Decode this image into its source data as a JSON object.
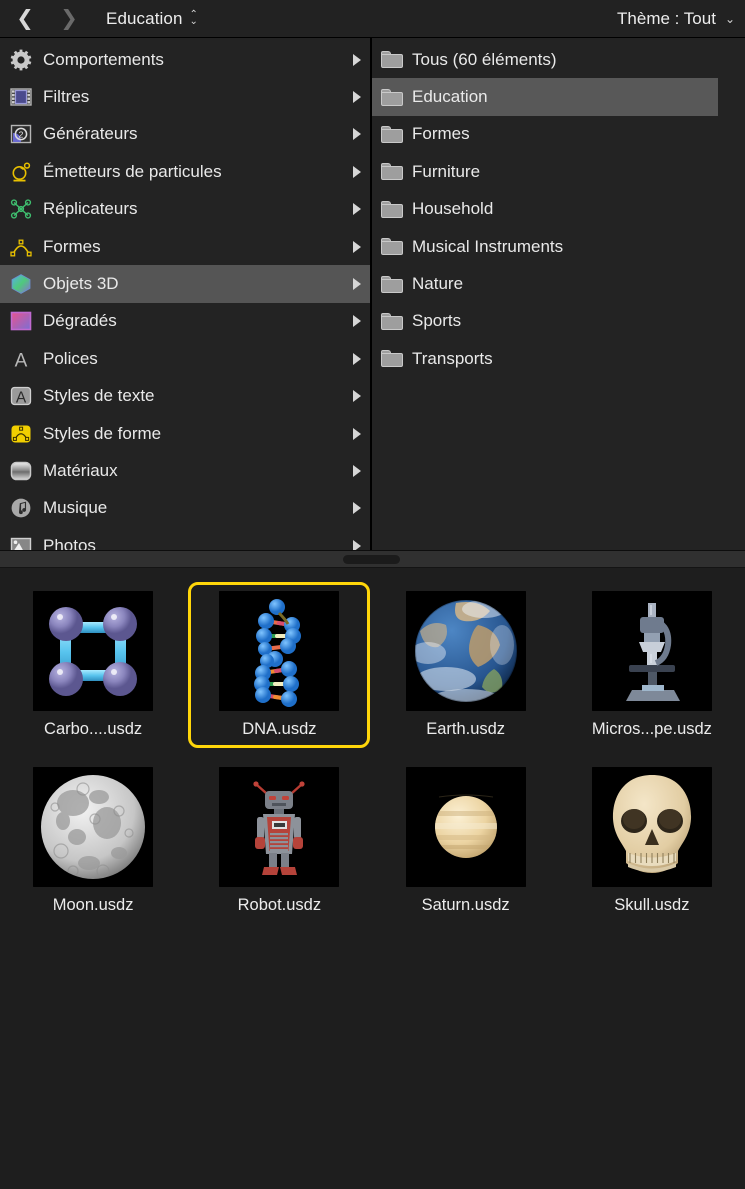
{
  "toolbar": {
    "back_icon": "chevron-left-icon",
    "forward_icon": "chevron-right-icon",
    "title": "Education",
    "stepper_up": "⌃",
    "stepper_down": "⌄",
    "theme_label": "Thème : Tout",
    "theme_chevron": "⌄"
  },
  "categories": [
    {
      "label": "Comportements",
      "icon": "gear-icon",
      "selected": false
    },
    {
      "label": "Filtres",
      "icon": "film-strip-icon",
      "selected": false
    },
    {
      "label": "Générateurs",
      "icon": "generator-icon",
      "selected": false
    },
    {
      "label": "Émetteurs de particules",
      "icon": "particle-emitter-icon",
      "selected": false
    },
    {
      "label": "Réplicateurs",
      "icon": "replicator-icon",
      "selected": false
    },
    {
      "label": "Formes",
      "icon": "shape-curve-icon",
      "selected": false
    },
    {
      "label": "Objets 3D",
      "icon": "cube-3d-icon",
      "selected": true
    },
    {
      "label": "Dégradés",
      "icon": "gradient-swatch-icon",
      "selected": false
    },
    {
      "label": "Polices",
      "icon": "font-a-icon",
      "selected": false
    },
    {
      "label": "Styles de texte",
      "icon": "text-style-icon",
      "selected": false
    },
    {
      "label": "Styles de forme",
      "icon": "shape-style-icon",
      "selected": false
    },
    {
      "label": "Matériaux",
      "icon": "material-icon",
      "selected": false
    },
    {
      "label": "Musique",
      "icon": "music-note-icon",
      "selected": false
    },
    {
      "label": "Photos",
      "icon": "photo-icon",
      "selected": false
    }
  ],
  "folders": [
    {
      "label": "Tous (60 éléments)",
      "selected": false
    },
    {
      "label": "Education",
      "selected": true
    },
    {
      "label": "Formes",
      "selected": false
    },
    {
      "label": "Furniture",
      "selected": false
    },
    {
      "label": "Household",
      "selected": false
    },
    {
      "label": "Musical Instruments",
      "selected": false
    },
    {
      "label": "Nature",
      "selected": false
    },
    {
      "label": "Sports",
      "selected": false
    },
    {
      "label": "Transports",
      "selected": false
    }
  ],
  "assets": [
    {
      "label": "Carbo....usdz",
      "art": "carbon",
      "selected": false
    },
    {
      "label": "DNA.usdz",
      "art": "dna",
      "selected": true
    },
    {
      "label": "Earth.usdz",
      "art": "earth",
      "selected": false
    },
    {
      "label": "Micros...pe.usdz",
      "art": "microscope",
      "selected": false
    },
    {
      "label": "Moon.usdz",
      "art": "moon",
      "selected": false
    },
    {
      "label": "Robot.usdz",
      "art": "robot",
      "selected": false
    },
    {
      "label": "Saturn.usdz",
      "art": "saturn",
      "selected": false
    },
    {
      "label": "Skull.usdz",
      "art": "skull",
      "selected": false
    }
  ],
  "colors": {
    "background": "#1e1e1e",
    "panel": "#232323",
    "toolbar": "#222222",
    "selection_row": "#555555",
    "selection_accent": "#ffd60a",
    "text": "#ececec"
  }
}
